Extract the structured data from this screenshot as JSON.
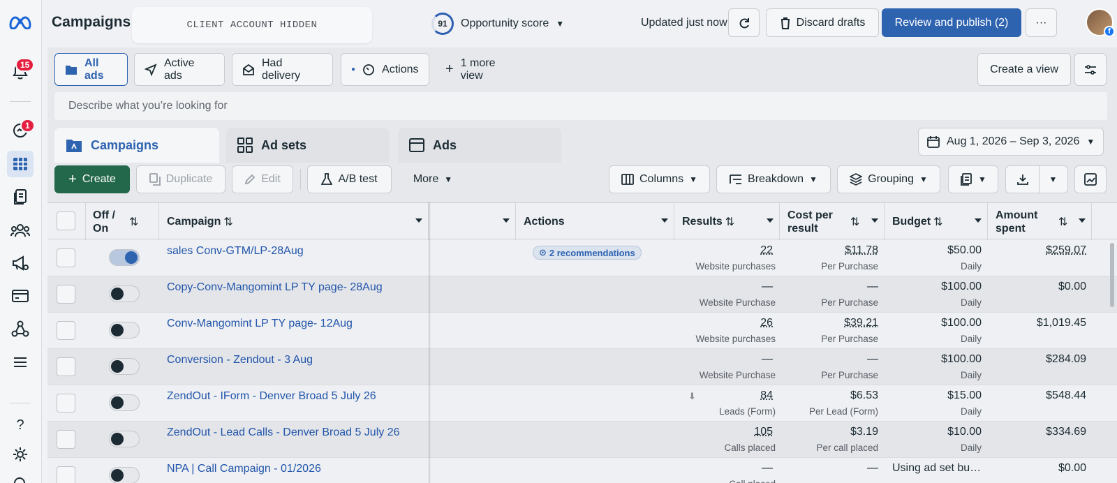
{
  "rail": {
    "notifications_badge": "15",
    "messages_badge": "1"
  },
  "header": {
    "title": "Campaigns",
    "account_placeholder": "CLIENT ACCOUNT HIDDEN",
    "opportunity_score": "91",
    "opportunity_label": "Opportunity score",
    "updated_text": "Updated just now",
    "discard_label": "Discard drafts",
    "review_label": "Review and publish (2)",
    "more_label": "···"
  },
  "views": {
    "all_ads": "All ads",
    "active_ads": "Active ads",
    "had_delivery": "Had delivery",
    "actions": "Actions",
    "more_view": "1 more view",
    "create_view": "Create a view"
  },
  "search": {
    "placeholder": "Describe what you’re looking for"
  },
  "level_tabs": {
    "campaigns": "Campaigns",
    "ad_sets": "Ad sets",
    "ads": "Ads"
  },
  "date_range": "Aug 1, 2026 – Sep 3, 2026",
  "toolbar": {
    "create": "Create",
    "duplicate": "Duplicate",
    "edit": "Edit",
    "ab_test": "A/B test",
    "more": "More",
    "columns": "Columns",
    "breakdown": "Breakdown",
    "grouping": "Grouping"
  },
  "columns": {
    "off_on": "Off / On",
    "campaign": "Campaign",
    "actions": "Actions",
    "results": "Results",
    "cost_per_result": "Cost per result",
    "budget": "Budget",
    "amount_spent": "Amount spent"
  },
  "recommendations_label": "2 recommendations",
  "rows": [
    {
      "name": "sales Conv-GTM/LP-28Aug",
      "on": true,
      "results": "22",
      "results_type": "Website purchases",
      "cost": "$11.78",
      "cost_type": "Per Purchase",
      "budget": "$50.00",
      "budget_type": "Daily",
      "spent": "$259.07"
    },
    {
      "name": "Copy-Conv-Mangomint LP TY page- 28Aug",
      "on": false,
      "results": "—",
      "results_type": "Website Purchase",
      "cost": "—",
      "cost_type": "Per Purchase",
      "budget": "$100.00",
      "budget_type": "Daily",
      "spent": "$0.00"
    },
    {
      "name": "Conv-Mangomint LP TY page- 12Aug",
      "on": false,
      "results": "26",
      "results_type": "Website purchases",
      "cost": "$39.21",
      "cost_type": "Per Purchase",
      "budget": "$100.00",
      "budget_type": "Daily",
      "spent": "$1,019.45"
    },
    {
      "name": "Conversion - Zendout - 3 Aug",
      "on": false,
      "results": "—",
      "results_type": "Website Purchase",
      "cost": "—",
      "cost_type": "Per Purchase",
      "budget": "$100.00",
      "budget_type": "Daily",
      "spent": "$284.09"
    },
    {
      "name": "ZendOut - IForm - Denver Broad 5 July 26",
      "on": false,
      "results": "84",
      "results_type": "Leads (Form)",
      "cost": "$6.53",
      "cost_type": "Per Lead (Form)",
      "budget": "$15.00",
      "budget_type": "Daily",
      "spent": "$548.44"
    },
    {
      "name": "ZendOut - Lead Calls - Denver Broad 5 July 26",
      "on": false,
      "results": "105",
      "results_type": "Calls placed",
      "cost": "$3.19",
      "cost_type": "Per call placed",
      "budget": "$10.00",
      "budget_type": "Daily",
      "spent": "$334.69"
    },
    {
      "name": "NPA | Call Campaign - 01/2026",
      "on": false,
      "results": "—",
      "results_type": "Call placed",
      "cost": "—",
      "cost_type": "",
      "budget": "Using ad set bu…",
      "budget_type": "",
      "spent": "$0.00"
    }
  ]
}
